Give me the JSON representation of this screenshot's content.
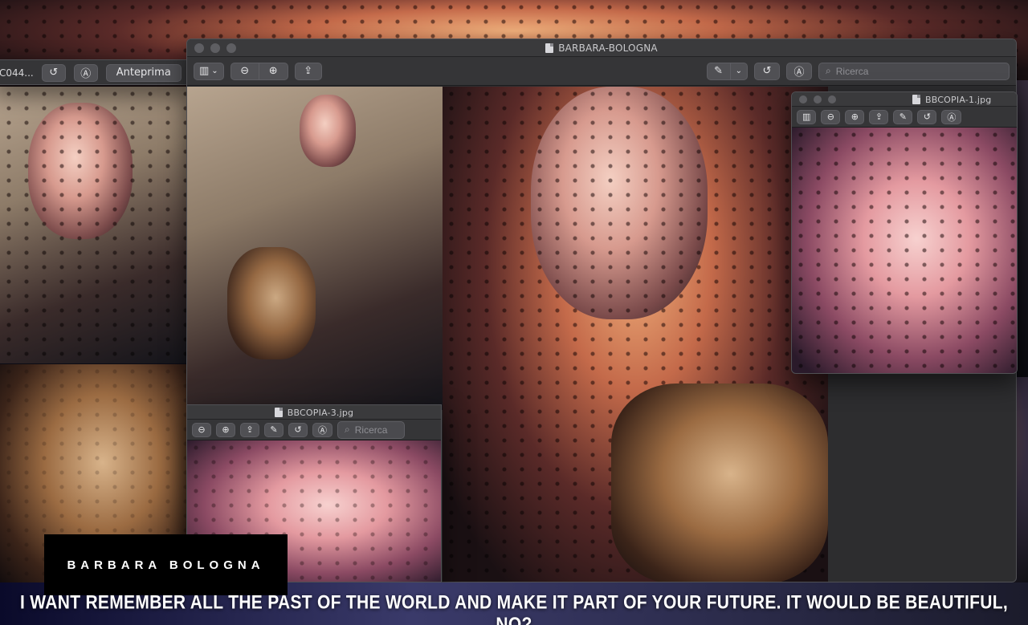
{
  "background_window": {
    "title_fragment": "C044...",
    "rotate_label": "↺",
    "markup_label": "Ⓐ",
    "preview_label": "Anteprima"
  },
  "main_window": {
    "title": "BARBARA-BOLOGNA",
    "search_placeholder": "Ricerca",
    "buttons": {
      "sidebar": "▥",
      "chevron": "⌄",
      "zoom_out": "⊖",
      "zoom_in": "⊕",
      "share": "⇪",
      "pen": "✎",
      "rotate": "↺",
      "markup": "Ⓐ"
    }
  },
  "window_copia1": {
    "title": "BBCOPIA-1.jpg"
  },
  "window_copia3": {
    "title": "BBCOPIA-3.jpg",
    "search_placeholder": "Ricerca"
  },
  "overlay": {
    "name": "BARBARA BOLOGNA",
    "caption": "I WANT REMEMBER ALL THE PAST OF THE WORLD AND MAKE IT PART OF YOUR FUTURE. IT WOULD BE BEAUTIFUL, NO?"
  },
  "colors": {
    "window_bg": "#2d2d2f",
    "titlebar": "#3a3a3c",
    "toolbar_button": "#505054",
    "caption_text": "#ffffff",
    "name_box": "#000000"
  }
}
